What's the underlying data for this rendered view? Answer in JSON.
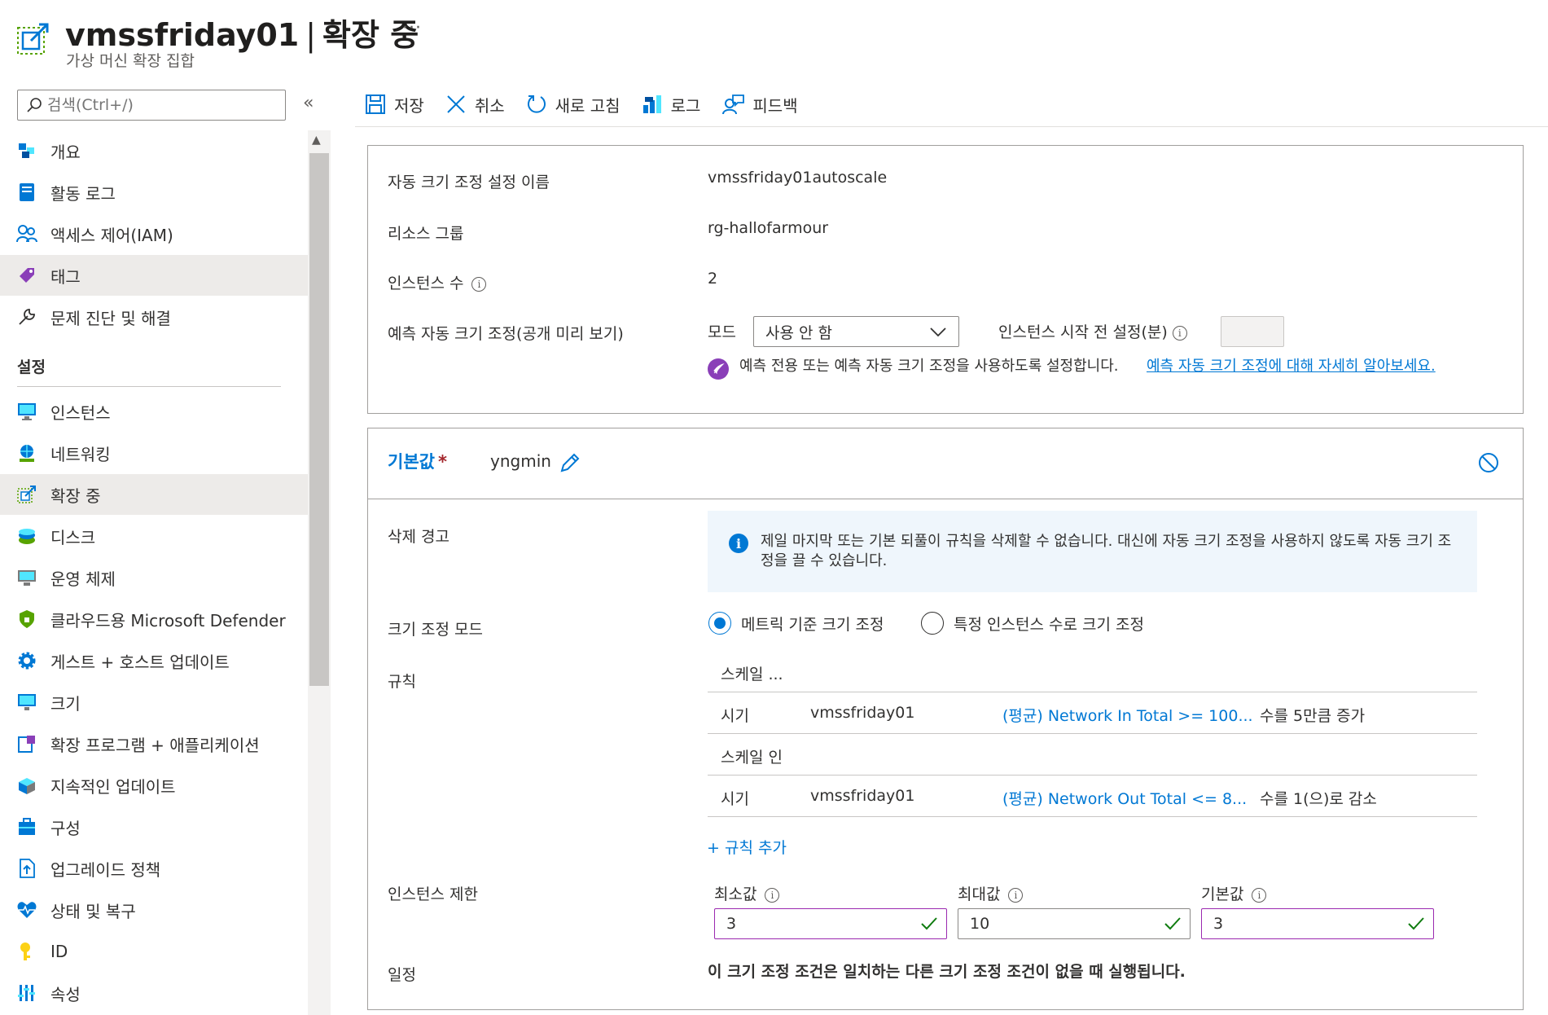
{
  "header": {
    "resource_name": "vmssfriday01",
    "separator": "|",
    "blade_title": "확장 중",
    "subtitle": "가상 머신 확장 집합",
    "more": "···"
  },
  "search": {
    "placeholder": "검색(Ctrl+/)"
  },
  "collapse_label": "«",
  "sidebar": {
    "items_top": [
      {
        "label": "개요",
        "icon": "overview-icon"
      },
      {
        "label": "활동 로그",
        "icon": "activity-log-icon"
      },
      {
        "label": "액세스 제어(IAM)",
        "icon": "iam-icon"
      },
      {
        "label": "태그",
        "icon": "tag-icon"
      },
      {
        "label": "문제 진단 및 해결",
        "icon": "wrench-icon"
      }
    ],
    "section_settings": "설정",
    "items_settings": [
      {
        "label": "인스턴스",
        "icon": "instances-icon"
      },
      {
        "label": "네트워킹",
        "icon": "networking-icon"
      },
      {
        "label": "확장 중",
        "icon": "scaling-icon"
      },
      {
        "label": "디스크",
        "icon": "disk-icon"
      },
      {
        "label": "운영 체제",
        "icon": "os-icon"
      },
      {
        "label": "클라우드용 Microsoft Defender",
        "icon": "defender-icon"
      },
      {
        "label": "게스트 + 호스트 업데이트",
        "icon": "gear-icon"
      },
      {
        "label": "크기",
        "icon": "size-icon"
      },
      {
        "label": "확장 프로그램 + 애플리케이션",
        "icon": "extensions-icon"
      },
      {
        "label": "지속적인 업데이트",
        "icon": "continuous-update-icon"
      },
      {
        "label": "구성",
        "icon": "configuration-icon"
      },
      {
        "label": "업그레이드 정책",
        "icon": "upgrade-policy-icon"
      },
      {
        "label": "상태 및 복구",
        "icon": "health-icon"
      },
      {
        "label": "ID",
        "icon": "identity-icon"
      },
      {
        "label": "속성",
        "icon": "properties-icon"
      }
    ]
  },
  "toolbar": {
    "save": "저장",
    "discard": "취소",
    "refresh": "새로 고침",
    "logs": "로그",
    "feedback": "피드백"
  },
  "settings": {
    "name_label": "자동 크기 조정 설정 이름",
    "name_value": "vmssfriday01autoscale",
    "rg_label": "리소스 그룹",
    "rg_value": "rg-hallofarmour",
    "count_label": "인스턴스 수",
    "count_value": "2",
    "predictive_label": "예측 자동 크기 조정(공개 미리 보기)",
    "mode_label": "모드",
    "mode_value": "사용 안 함",
    "prewarm_label": "인스턴스 시작 전 설정(분)",
    "predictive_note": "예측 전용 또는 예측 자동 크기 조정을 사용하도록 설정합니다.",
    "predictive_link": "예측 자동 크기 조정에 대해 자세히 알아보세요."
  },
  "profile": {
    "label": "기본값",
    "required": "*",
    "name": "yngmin",
    "delete_warning_label": "삭제 경고",
    "delete_warning_text": "제일 마지막 또는 기본 되풀이 규칙을 삭제할 수 없습니다. 대신에 자동 크기 조정을 사용하지 않도록 자동 크기 조정을 끌 수 있습니다.",
    "scale_mode_label": "크기 조정 모드",
    "scale_mode_metric": "메트릭 기준 크기 조정",
    "scale_mode_specific": "특정 인스턴스 수로 크기 조정",
    "rules_label": "규칙",
    "scale_out_header": "스케일 ...",
    "scale_in_header": "스케일 인",
    "rules": [
      {
        "when": "시기",
        "resource": "vmssfriday01",
        "metric": "(평균) Network In Total >= 100...",
        "action": "수를 5만큼 증가"
      },
      {
        "when": "시기",
        "resource": "vmssfriday01",
        "metric": "(평균) Network Out Total <= 8...",
        "action": "수를 1(으)로 감소"
      }
    ],
    "add_rule": "+ 규칙 추가",
    "limits_label": "인스턴스 제한",
    "min_label": "최소값",
    "min_value": "3",
    "max_label": "최대값",
    "max_value": "10",
    "default_label": "기본값",
    "default_value": "3",
    "schedule_label": "일정",
    "schedule_note": "이 크기 조정 조건은 일치하는 다른 크기 조정 조건이 없을 때 실행됩니다."
  },
  "colors": {
    "accent": "#0078d4",
    "valid_border": "#9b29b0",
    "check": "#107c10",
    "required": "#a4262c"
  }
}
